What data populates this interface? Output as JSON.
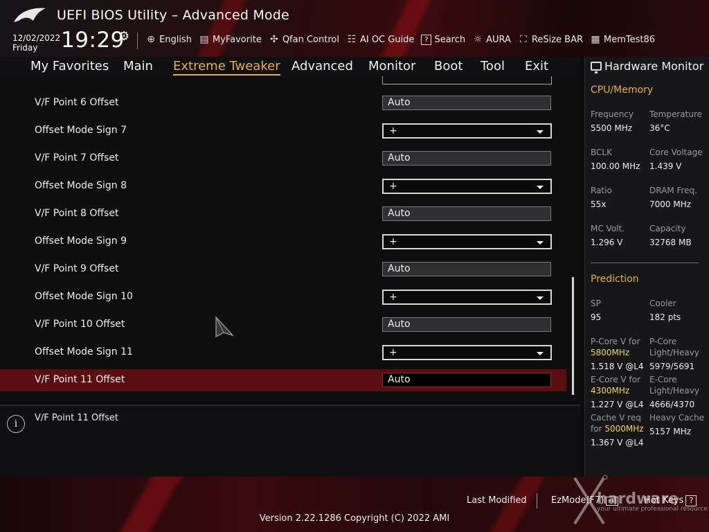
{
  "header": {
    "title": "UEFI BIOS Utility – Advanced Mode",
    "date": "12/02/2022",
    "day": "Friday",
    "time": "19:29",
    "toolbar": [
      {
        "label": "English",
        "icon": "globe-icon"
      },
      {
        "label": "MyFavorite",
        "icon": "favorite-icon"
      },
      {
        "label": "Qfan Control",
        "icon": "fan-icon"
      },
      {
        "label": "AI OC Guide",
        "icon": "ai-guide-icon"
      },
      {
        "label": "Search",
        "icon": "search-icon"
      },
      {
        "label": "AURA",
        "icon": "aura-icon"
      },
      {
        "label": "ReSize BAR",
        "icon": "resize-bar-icon"
      },
      {
        "label": "MemTest86",
        "icon": "memtest-icon"
      }
    ]
  },
  "menu": {
    "items": [
      "My Favorites",
      "Main",
      "Extreme Tweaker",
      "Advanced",
      "Monitor",
      "Boot",
      "Tool",
      "Exit"
    ],
    "active": "Extreme Tweaker"
  },
  "settings": [
    {
      "label": "V/F Point 6 Offset",
      "type": "field",
      "value": "Auto"
    },
    {
      "label": "Offset Mode Sign 7",
      "type": "dropdown",
      "value": "+"
    },
    {
      "label": "V/F Point 7 Offset",
      "type": "field",
      "value": "Auto"
    },
    {
      "label": "Offset Mode Sign 8",
      "type": "dropdown",
      "value": "+"
    },
    {
      "label": "V/F Point 8 Offset",
      "type": "field",
      "value": "Auto"
    },
    {
      "label": "Offset Mode Sign 9",
      "type": "dropdown",
      "value": "+"
    },
    {
      "label": "V/F Point 9 Offset",
      "type": "field",
      "value": "Auto"
    },
    {
      "label": "Offset Mode Sign 10",
      "type": "dropdown",
      "value": "+"
    },
    {
      "label": "V/F Point 10 Offset",
      "type": "field",
      "value": "Auto"
    },
    {
      "label": "Offset Mode Sign 11",
      "type": "dropdown",
      "value": "+"
    },
    {
      "label": "V/F Point 11 Offset",
      "type": "field",
      "value": "Auto",
      "selected": true
    }
  ],
  "help": {
    "text": "V/F Point 11 Offset"
  },
  "hardware_monitor": {
    "title": "Hardware Monitor",
    "cpu_memory": {
      "section": "CPU/Memory",
      "frequency_label": "Frequency",
      "frequency": "5500 MHz",
      "temperature_label": "Temperature",
      "temperature": "36°C",
      "bclk_label": "BCLK",
      "bclk": "100.00 MHz",
      "core_voltage_label": "Core Voltage",
      "core_voltage": "1.439 V",
      "ratio_label": "Ratio",
      "ratio": "55x",
      "dram_freq_label": "DRAM Freq.",
      "dram_freq": "7000 MHz",
      "mc_volt_label": "MC Volt.",
      "mc_volt": "1.296 V",
      "capacity_label": "Capacity",
      "capacity": "32768 MB"
    },
    "prediction": {
      "section": "Prediction",
      "sp_label": "SP",
      "sp": "95",
      "cooler_label": "Cooler",
      "cooler": "182 pts",
      "pcore_v_label": "P-Core V for",
      "pcore_v_freq": "5800MHz",
      "pcore_v": "1.518 V @L4",
      "pcore_lh_label1": "P-Core",
      "pcore_lh_label2": "Light/Heavy",
      "pcore_lh": "5979/5691",
      "ecore_v_label": "E-Core V for",
      "ecore_v_freq": "4300MHz",
      "ecore_v": "1.227 V @L4",
      "ecore_lh_label1": "E-Core",
      "ecore_lh_label2": "Light/Heavy",
      "ecore_lh": "4666/4370",
      "cache_v_label1": "Cache V req",
      "cache_v_label2": "for",
      "cache_v_freq": "5000MHz",
      "cache_v": "1.367 V @L4",
      "heavy_cache_label": "Heavy Cache",
      "heavy_cache": "5157 MHz"
    }
  },
  "footer": {
    "last_modified": "Last Modified",
    "ez_mode": "EzMode(F7)",
    "hot_keys": "Hot Keys",
    "version": "Version 2.22.1286 Copyright (C) 2022 AMI"
  },
  "watermark": {
    "text": "hardware",
    "sub": "your ultimate professional resource"
  },
  "colors": {
    "accent": "#e8b23b",
    "selected_row": "#5a0e12",
    "highlight_value": "#f3d94a"
  }
}
